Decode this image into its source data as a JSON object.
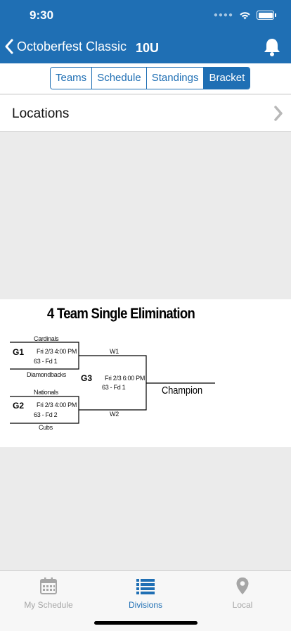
{
  "status_bar": {
    "time": "9:30"
  },
  "nav": {
    "title": "Octoberfest Classic",
    "division": "10U"
  },
  "segments": [
    {
      "label": "Teams",
      "active": false
    },
    {
      "label": "Schedule",
      "active": false
    },
    {
      "label": "Standings",
      "active": false
    },
    {
      "label": "Bracket",
      "active": true
    }
  ],
  "locations": {
    "label": "Locations"
  },
  "bracket": {
    "title": "4 Team Single Elimination",
    "g1": {
      "id": "G1",
      "top_team": "Cardinals",
      "bottom_team": "Diamondbacks",
      "datetime": "Fri 2/3  4:00 PM",
      "field": "63  - Fd 1"
    },
    "g2": {
      "id": "G2",
      "top_team": "Nationals",
      "bottom_team": "Cubs",
      "datetime": "Fri 2/3  4:00 PM",
      "field": "63  - Fd 2"
    },
    "g3": {
      "id": "G3",
      "top_team": "W1",
      "bottom_team": "W2",
      "datetime": "Fri 2/3  6:00 PM",
      "field": "63  - Fd 1"
    },
    "champion": "Champion"
  },
  "tabs": [
    {
      "label": "My Schedule",
      "icon": "calendar-icon",
      "active": false
    },
    {
      "label": "Divisions",
      "icon": "list-icon",
      "active": true
    },
    {
      "label": "Local",
      "icon": "location-pin-icon",
      "active": false
    }
  ],
  "colors": {
    "primary": "#1f6fb4",
    "background": "#ebebeb",
    "inactive": "#a6a6a6"
  }
}
